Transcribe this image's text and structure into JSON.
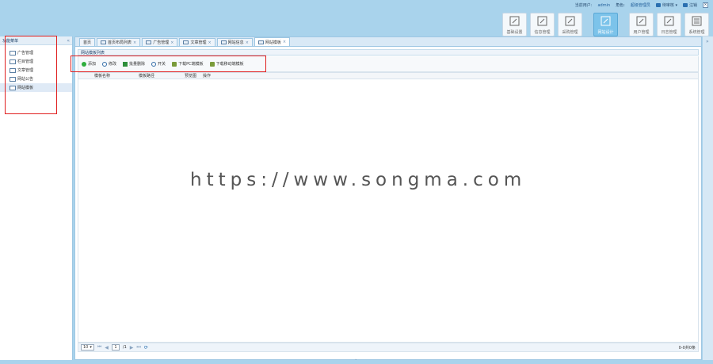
{
  "header": {
    "user_label": "当前用户:",
    "user_name": "admin",
    "role_label": "角色:",
    "role_name": "超级管理员",
    "notice_label": "待审核",
    "exit_label": "注销",
    "close_label": "×"
  },
  "modules": [
    {
      "label": "基础设置",
      "icon": "edit-icon"
    },
    {
      "label": "信息管理",
      "icon": "edit-icon"
    },
    {
      "label": "采购管理",
      "icon": "edit-icon"
    },
    {
      "label": "网站设计",
      "icon": "edit-icon",
      "active": true
    },
    {
      "label": "用户管理",
      "icon": "edit-icon"
    },
    {
      "label": "日志管理",
      "icon": "edit-icon"
    },
    {
      "label": "系统管理",
      "icon": "list-icon"
    }
  ],
  "sidebar": {
    "title": "功能菜单",
    "collapse": "«",
    "items": [
      {
        "label": "广告管理"
      },
      {
        "label": "栏目管理"
      },
      {
        "label": "文章管理"
      },
      {
        "label": "网站公告"
      },
      {
        "label": "网站模板",
        "selected": true
      }
    ]
  },
  "tabs": [
    {
      "label": "首页"
    },
    {
      "label": "首页布局列表"
    },
    {
      "label": "广告管理"
    },
    {
      "label": "文章管理"
    },
    {
      "label": "网站信息"
    },
    {
      "label": "网站模板",
      "active": true
    }
  ],
  "panel": {
    "title": "网站模板列表"
  },
  "toolbar": {
    "buttons": [
      {
        "label": "添加",
        "icon": "add-icon"
      },
      {
        "label": "修改",
        "icon": "search-icon"
      },
      {
        "label": "批量删除",
        "icon": "delete-icon"
      },
      {
        "label": "开关",
        "icon": "search-icon"
      },
      {
        "label": "下载PC端模板",
        "icon": "download-icon"
      },
      {
        "label": "下载移动端模板",
        "icon": "download-icon"
      }
    ]
  },
  "grid": {
    "columns": [
      "模板名称",
      "模板路径",
      "预览图",
      "操作"
    ]
  },
  "pager": {
    "page_size": "10",
    "current_page": "1",
    "total_pages": "/1",
    "info": "0-0共0条"
  },
  "watermark": "https://www.songma.com",
  "colors": {
    "header_bg": "#a9d3ec",
    "active_module": "#7cc3ea",
    "annotation": "#e02020"
  }
}
